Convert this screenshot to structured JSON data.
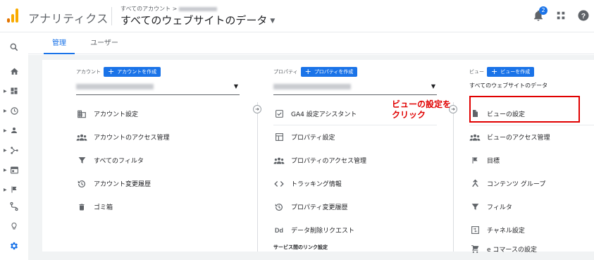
{
  "header": {
    "app_title": "アナリティクス",
    "breadcrumb": "すべてのアカウント >",
    "property_selector": "すべてのウェブサイトのデータ",
    "notification_count": "2"
  },
  "tabs": [
    {
      "label": "管理",
      "active": true
    },
    {
      "label": "ユーザー",
      "active": false
    }
  ],
  "account_col": {
    "heading": "アカウント",
    "create_label": "アカウントを作成",
    "items": [
      {
        "label": "アカウント設定",
        "icon": "building-icon"
      },
      {
        "label": "アカウントのアクセス管理",
        "icon": "people-icon"
      },
      {
        "label": "すべてのフィルタ",
        "icon": "filter-icon"
      },
      {
        "label": "アカウント変更履歴",
        "icon": "history-icon"
      },
      {
        "label": "ゴミ箱",
        "icon": "trash-icon"
      }
    ]
  },
  "property_col": {
    "heading": "プロパティ",
    "create_label": "プロパティを作成",
    "items": [
      {
        "label": "GA4 設定アシスタント",
        "icon": "checkbox-icon"
      },
      {
        "label": "プロパティ設定",
        "icon": "layout-icon"
      },
      {
        "label": "プロパティのアクセス管理",
        "icon": "people-icon"
      },
      {
        "label": "トラッキング情報",
        "icon": "code-icon"
      },
      {
        "label": "プロパティ変更履歴",
        "icon": "history-icon"
      },
      {
        "label": "データ削除リクエスト",
        "icon": "dd-icon"
      }
    ],
    "section_heading": "サービス間のリンク設定"
  },
  "view_col": {
    "heading": "ビュー",
    "create_label": "ビューを作成",
    "view_name": "すべてのウェブサイトのデータ",
    "items": [
      {
        "label": "ビューの設定",
        "icon": "document-icon"
      },
      {
        "label": "ビューのアクセス管理",
        "icon": "people-icon"
      },
      {
        "label": "目標",
        "icon": "flag-icon"
      },
      {
        "label": "コンテンツ グループ",
        "icon": "tree-icon"
      },
      {
        "label": "フィルタ",
        "icon": "filter-icon"
      },
      {
        "label": "チャネル設定",
        "icon": "channel-icon"
      },
      {
        "label": "e コマースの設定",
        "icon": "cart-icon"
      }
    ]
  },
  "annotation": {
    "line1": "ビューの設定を",
    "line2": "クリック",
    "color": "#e00000"
  },
  "colors": {
    "accent": "#1a73e8",
    "logo_orange": "#f9ab00",
    "logo_dark": "#e37400"
  }
}
